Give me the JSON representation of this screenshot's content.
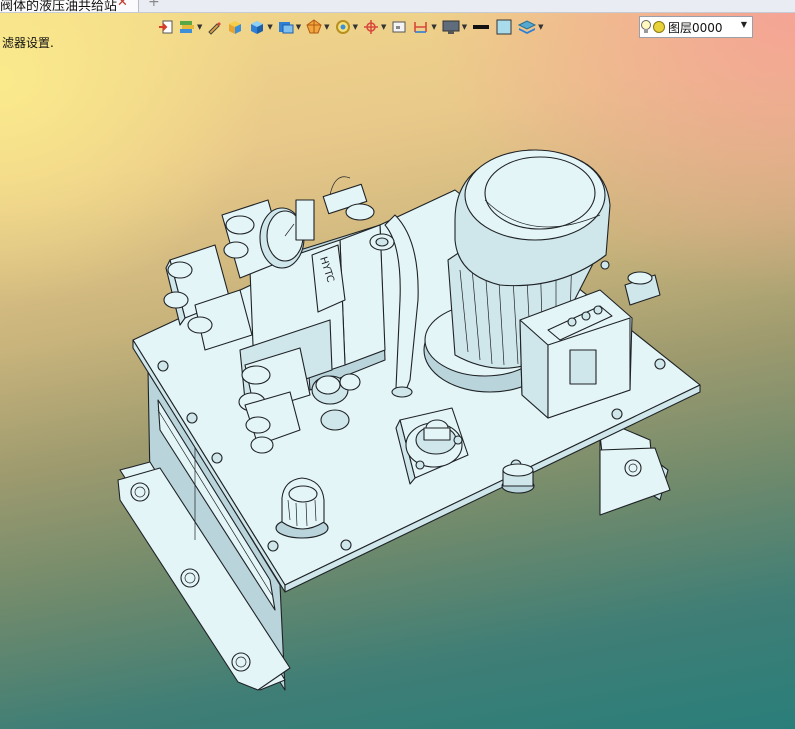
{
  "tab": {
    "title": "阀体的液压油共给站",
    "close_glyph": "✕",
    "add_glyph": "+"
  },
  "status": {
    "text": "滤器设置."
  },
  "toolbar": {
    "icons": [
      "exit-sketch-icon",
      "layers-stack-icon",
      "pencil-icon",
      "shaded-cube-icon",
      "cube-icon",
      "view-orientation-icon",
      "render-style-icon",
      "zoom-fit-icon",
      "origin-crosshair-icon",
      "section-box-icon",
      "dimension-icon",
      "display-monitor-icon",
      "line-color-swatch",
      "fill-color-swatch",
      "layer-manager-icon"
    ]
  },
  "layer": {
    "label": "图层0000"
  },
  "model": {
    "brand_label": "HYTC"
  },
  "colors": {
    "part_fill": "#e4f5f8",
    "part_shadow": "#b9d4da",
    "edge": "#1f2326",
    "accent_blue": "#2e7fd6"
  }
}
